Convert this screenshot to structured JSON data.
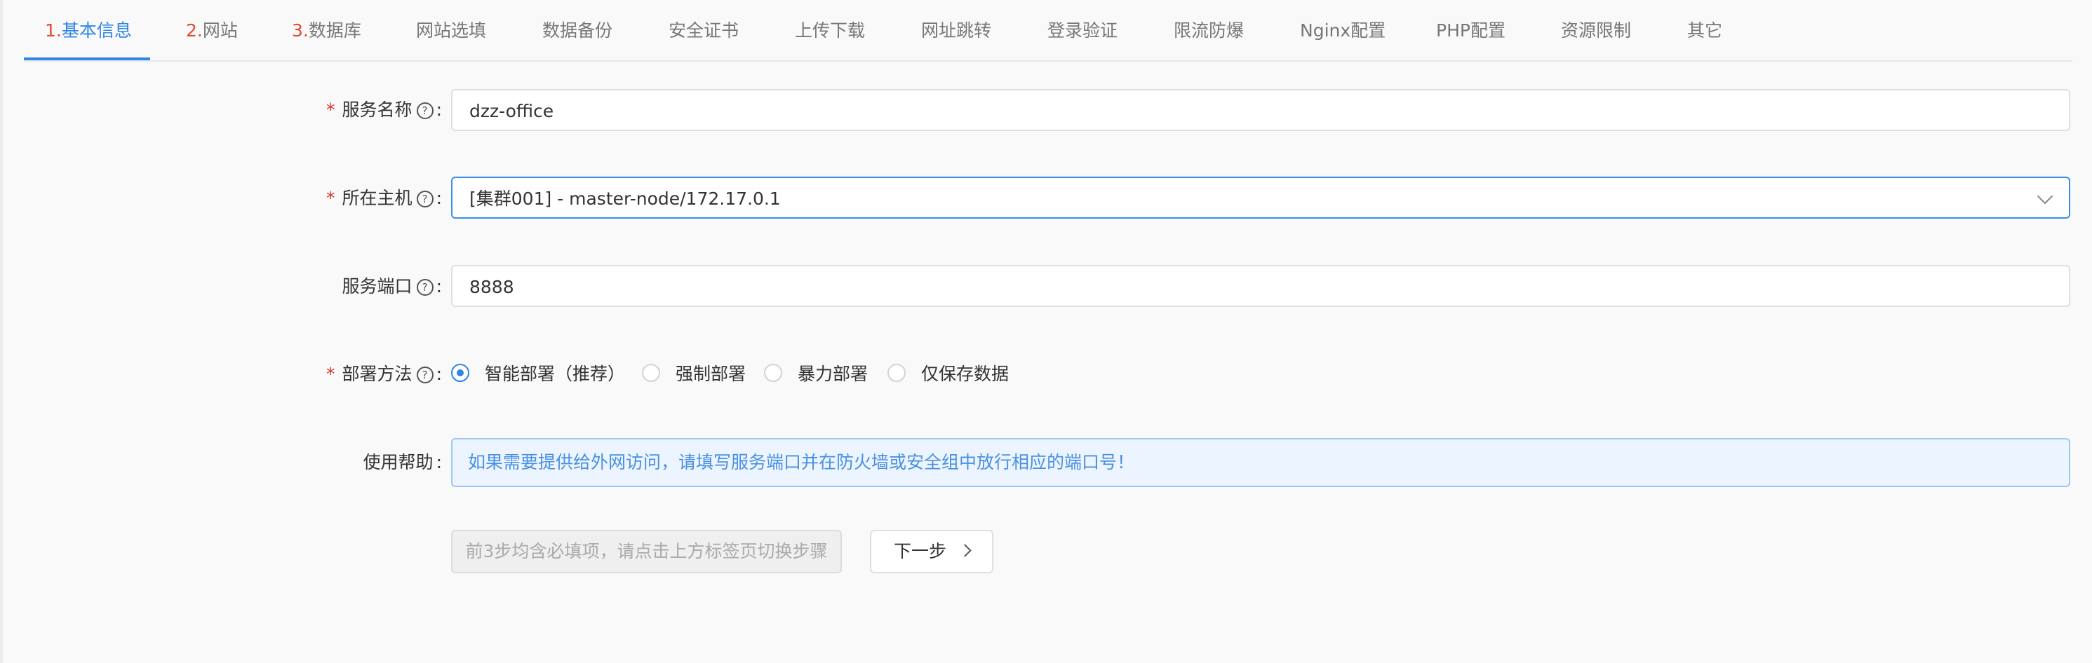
{
  "tabs": [
    {
      "num": "1.",
      "label": "基本信息",
      "active": true
    },
    {
      "num": "2.",
      "label": "网站"
    },
    {
      "num": "3.",
      "label": "数据库"
    },
    {
      "num": "",
      "label": "网站选填"
    },
    {
      "num": "",
      "label": "数据备份"
    },
    {
      "num": "",
      "label": "安全证书"
    },
    {
      "num": "",
      "label": "上传下载"
    },
    {
      "num": "",
      "label": "网址跳转"
    },
    {
      "num": "",
      "label": "登录验证"
    },
    {
      "num": "",
      "label": "限流防爆"
    },
    {
      "num": "",
      "label": "Nginx配置"
    },
    {
      "num": "",
      "label": "PHP配置"
    },
    {
      "num": "",
      "label": "资源限制"
    },
    {
      "num": "",
      "label": "其它"
    }
  ],
  "form": {
    "required_mark": "*",
    "help_glyph": "?",
    "colon": ":",
    "service_name": {
      "label": "服务名称",
      "value": "dzz-office"
    },
    "host": {
      "label": "所在主机",
      "value": "[集群001] - master-node/172.17.0.1"
    },
    "port": {
      "label": "服务端口",
      "value": "8888"
    },
    "deploy": {
      "label": "部署方法",
      "options": [
        "智能部署（推荐）",
        "强制部署",
        "暴力部署",
        "仅保存数据"
      ],
      "selected": "智能部署（推荐）"
    },
    "usage_help": {
      "label": "使用帮助",
      "text": "如果需要提供给外网访问，请填写服务端口并在防火墙或安全组中放行相应的端口号！"
    }
  },
  "buttons": {
    "disabled_hint": "前3步均含必填项，请点击上方标签页切换步骤",
    "next": "下一步"
  },
  "colors": {
    "accent": "#2f86e6",
    "required": "#e0362d",
    "step_number": "#e04a32",
    "tip_background": "#ecf5ff"
  }
}
